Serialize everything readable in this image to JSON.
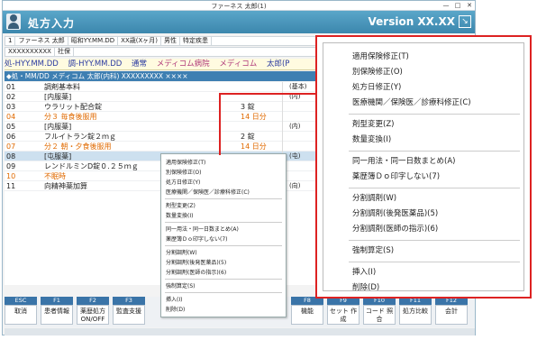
{
  "window": {
    "title": "ファーネス 太郎(1)",
    "min": "—",
    "max": "□",
    "close": "✕"
  },
  "header": {
    "title": "処方入力",
    "version": "Version XX.XX",
    "icon": "settings-icon"
  },
  "patient": {
    "line1": [
      "1",
      "ファーネス 太郎",
      "昭和YY.MM.DD",
      "XX歳(Xヶ月)",
      "男性",
      "特定疾患"
    ],
    "line2": [
      "XXXXXXXXXX",
      "社保"
    ]
  },
  "infobar": {
    "items": [
      "処-HYY.MM.DD",
      "調-HYY.MM.DD",
      "通常",
      "メディコム病院",
      "メディコム",
      "太郎(P"
    ],
    "pink_index": [
      3,
      4
    ]
  },
  "subbar": {
    "text": "◆処・MM/DD メディコム 太郎(内科)  XXXXXXXXX ××××"
  },
  "rows": [
    {
      "no": "01",
      "name": "調剤基本料",
      "qty": "",
      "note": "(基本)",
      "orange": false,
      "sel": false
    },
    {
      "no": "02",
      "name": "[内服薬]",
      "qty": "",
      "note": "(内)",
      "orange": false,
      "sel": false
    },
    {
      "no": "03",
      "name": "ウラリット配合錠",
      "qty": "3 錠",
      "note": "",
      "orange": false,
      "sel": false
    },
    {
      "no": "04",
      "name": "分３ 毎食後服用",
      "qty": "14 日分",
      "note": "",
      "orange": true,
      "sel": false
    },
    {
      "no": "05",
      "name": "[内服薬]",
      "qty": "",
      "note": "(内)",
      "orange": false,
      "sel": false
    },
    {
      "no": "06",
      "name": "フルイトラン錠２ｍｇ",
      "qty": "2 錠",
      "note": "",
      "orange": false,
      "sel": false
    },
    {
      "no": "07",
      "name": "分２ 朝・夕食後服用",
      "qty": "14 日分",
      "note": "",
      "orange": true,
      "sel": false
    },
    {
      "no": "08",
      "name": "[屯服薬]",
      "qty": "",
      "note": "(屯)",
      "orange": false,
      "sel": true
    },
    {
      "no": "09",
      "name": "レンドルミンD錠０.２５ｍｇ",
      "qty": "",
      "note": "",
      "orange": false,
      "sel": false
    },
    {
      "no": "10",
      "name": "不眠時",
      "qty": "",
      "note": "",
      "orange": true,
      "sel": false
    },
    {
      "no": "11",
      "name": "向精神薬加算",
      "qty": "",
      "note": "(向)",
      "orange": false,
      "sel": false
    }
  ],
  "fkeys": [
    {
      "key": "ESC",
      "label": "取消"
    },
    {
      "key": "F1",
      "label": "患者情報"
    },
    {
      "key": "F2",
      "label": "薬歴処方 ON/OFF"
    },
    {
      "key": "F3",
      "label": "監査支援"
    },
    {
      "key": "F8",
      "label": "機能"
    },
    {
      "key": "F9",
      "label": "セット 作成"
    },
    {
      "key": "F10",
      "label": "コード 照合"
    },
    {
      "key": "F11",
      "label": "処方比較"
    },
    {
      "key": "F12",
      "label": "会計"
    }
  ],
  "context_menu": {
    "groups": [
      [
        "適用保険修正(T)",
        "別保険修正(O)",
        "処方日修正(Y)",
        "医療機関／保険医／診療科修正(C)"
      ],
      [
        "剤型変更(Z)",
        "数量変換(I)"
      ],
      [
        "同一用法・同一日数まとめ(A)",
        "薬歴簿Ｄｏ印字しない(7)"
      ],
      [
        "分割調剤(W)",
        "分割調剤(後発医薬品)(5)",
        "分割調剤(医師の指示)(6)"
      ],
      [
        "強制算定(S)"
      ],
      [
        "挿入(I)",
        "削除(D)"
      ]
    ]
  },
  "colors": {
    "accent": "#3e7fb2",
    "highlight_border": "#dd2222",
    "orange_text": "#e06a00"
  }
}
